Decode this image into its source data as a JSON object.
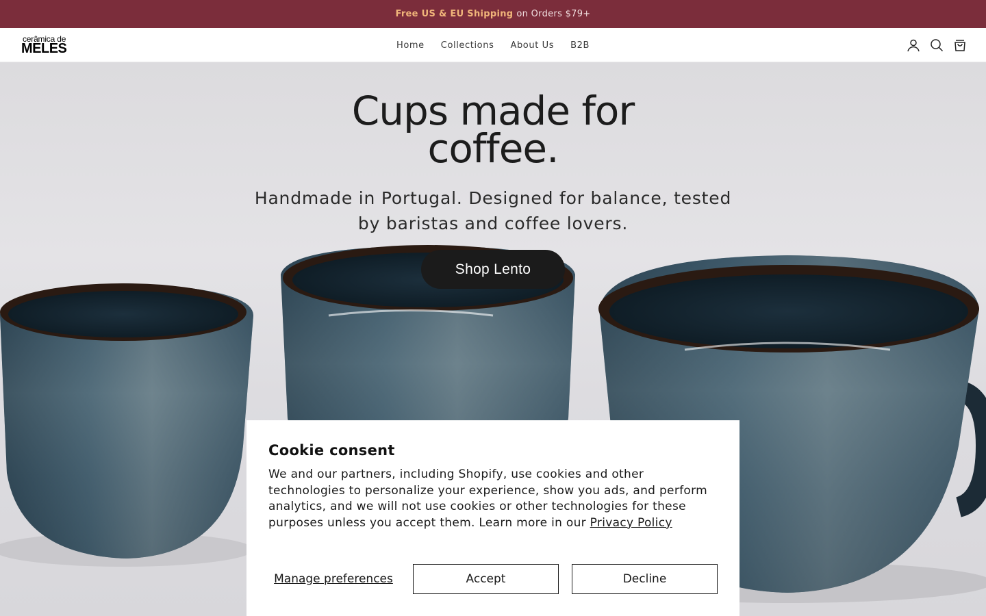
{
  "announcement": {
    "highlight": "Free US & EU Shipping",
    "rest": "on Orders $79+"
  },
  "header": {
    "logo": {
      "top": "cerâmica de",
      "main": "MELES"
    },
    "nav": [
      "Home",
      "Collections",
      "About Us",
      "B2B"
    ],
    "icons": [
      "account-icon",
      "search-icon",
      "cart-icon"
    ]
  },
  "hero": {
    "title_line1": "Cups made for",
    "title_line2": "coffee.",
    "subtitle_line1": "Handmade in Portugal. Designed for balance, tested",
    "subtitle_line2": "by baristas and coffee lovers.",
    "button": "Shop Lento"
  },
  "cookie": {
    "title": "Cookie consent",
    "body": "We and our partners, including Shopify, use cookies and other technologies to personalize your experience, show you ads, and perform analytics, and we will not use cookies or other technologies for these purposes unless you accept them. Learn more in our",
    "link": "Privacy Policy",
    "manage": "Manage preferences",
    "accept": "Accept",
    "decline": "Decline"
  },
  "colors": {
    "announcement_bg": "#7b2d3b",
    "announcement_highlight": "#f0b57a",
    "button_bg": "#1b1b1b",
    "glaze": "#3d5a6b"
  }
}
